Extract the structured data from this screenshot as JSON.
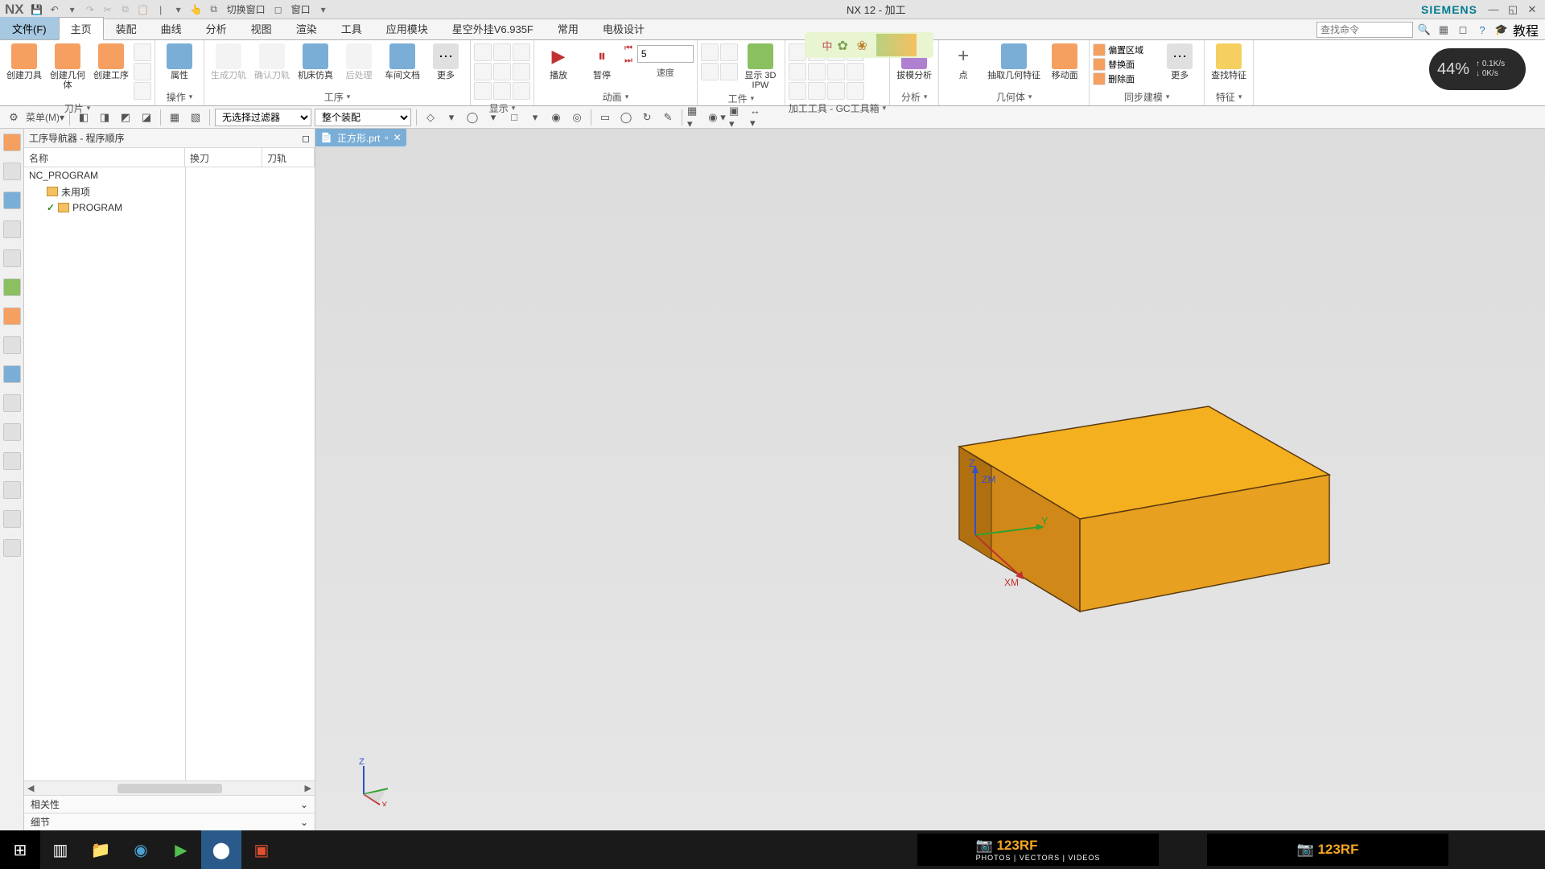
{
  "titlebar": {
    "app": "NX",
    "title": "NX 12 - 加工",
    "brand": "SIEMENS",
    "qat_switch": "切换窗口",
    "qat_window": "窗口"
  },
  "tabs": {
    "file": "文件(F)",
    "items": [
      "主页",
      "装配",
      "曲线",
      "分析",
      "视图",
      "渲染",
      "工具",
      "应用模块",
      "星空外挂V6.935F",
      "常用",
      "电极设计"
    ],
    "active": "主页",
    "search_placeholder": "查找命令",
    "tutorial": "教程"
  },
  "ribbon": {
    "groups": [
      {
        "label": "刀片",
        "items": [
          {
            "label": "创建刀具"
          },
          {
            "label": "创建几何体"
          },
          {
            "label": "创建工序"
          }
        ]
      },
      {
        "label": "操作",
        "items": [
          {
            "label": "属性"
          }
        ]
      },
      {
        "label": "",
        "items": [
          {
            "label": "生成刀轨",
            "disabled": true
          },
          {
            "label": "确认刀轨",
            "disabled": true
          },
          {
            "label": "机床仿真"
          },
          {
            "label": "后处理",
            "disabled": true
          },
          {
            "label": "车间文档"
          },
          {
            "label": "更多"
          }
        ]
      },
      {
        "label": "工序"
      },
      {
        "label": "显示"
      },
      {
        "label": "动画",
        "items": [
          {
            "label": "播放"
          },
          {
            "label": "暂停"
          }
        ],
        "extra": "速度",
        "speed": "5"
      },
      {
        "label": "工件",
        "items": [
          {
            "label": "显示 3D IPW"
          }
        ]
      },
      {
        "label": "加工工具 - GC工具箱"
      },
      {
        "label": "分析",
        "items": [
          {
            "label": "拔模分析"
          }
        ]
      },
      {
        "label": "几何体",
        "items": [
          {
            "label": "点"
          },
          {
            "label": "抽取几何特征"
          },
          {
            "label": "移动面"
          }
        ]
      },
      {
        "label": "同步建模",
        "items": [
          {
            "label": "偏置区域"
          },
          {
            "label": "替换面"
          },
          {
            "label": "删除面"
          },
          {
            "label": "更多"
          }
        ]
      },
      {
        "label": "特征",
        "items": [
          {
            "label": "查找特征"
          }
        ]
      }
    ]
  },
  "perf": {
    "pct": "44%",
    "up": "0.1K/s",
    "down": "0K/s"
  },
  "toolbar2": {
    "menu": "菜单(M)",
    "filter1": "无选择过滤器",
    "filter2": "整个装配"
  },
  "nav": {
    "title": "工序导航器 - 程序顺序",
    "headers": [
      "名称",
      "换刀",
      "刀轨"
    ],
    "root": "NC_PROGRAM",
    "items": [
      "未用项",
      "PROGRAM"
    ],
    "sections": [
      "相关性",
      "细节"
    ]
  },
  "doc": {
    "name": "正方形.prt"
  },
  "axes": {
    "z": "Z",
    "zm": "ZM",
    "y": "Y",
    "xm": "XM",
    "x": "X"
  },
  "taskbar": {
    "ad_brand": "123RF",
    "ad_sub": "PHOTOS | VECTORS | VIDEOS"
  }
}
